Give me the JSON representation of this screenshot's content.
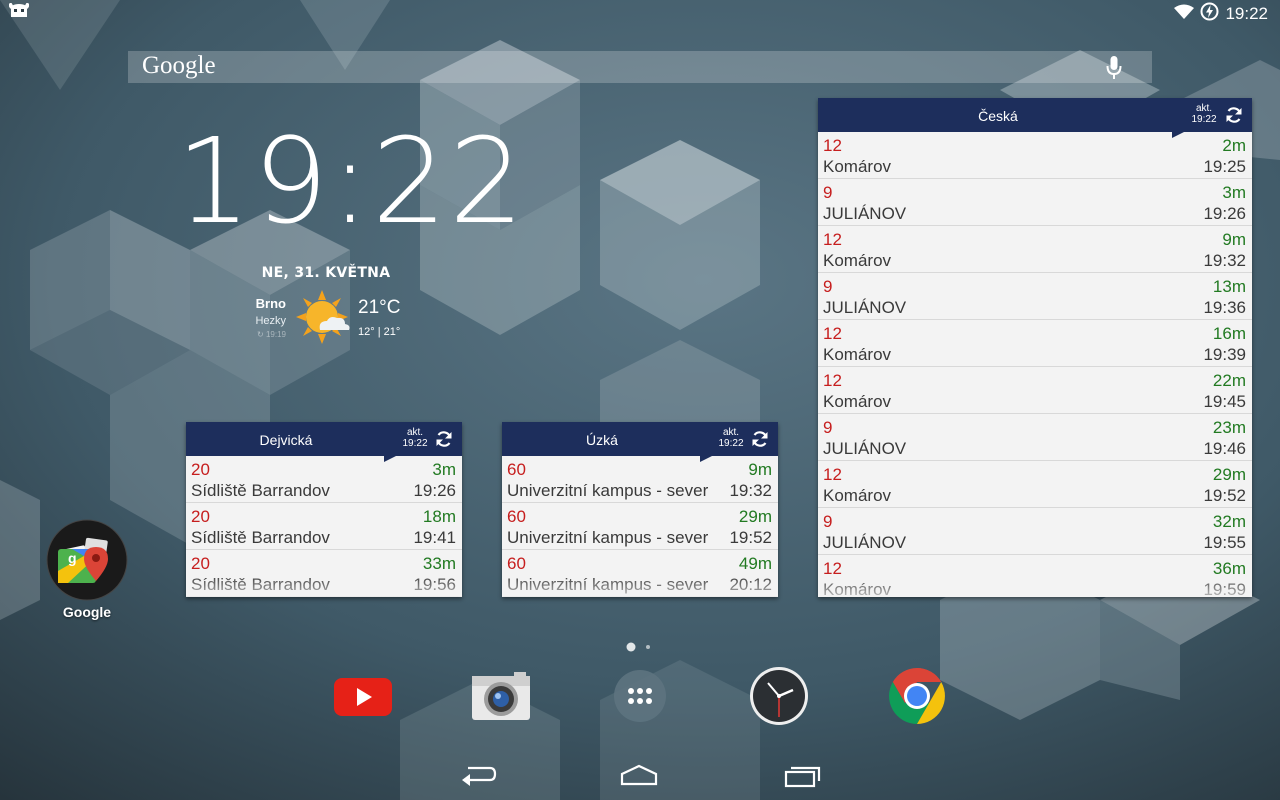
{
  "status": {
    "time": "19:22"
  },
  "search": {
    "logo": "Google"
  },
  "clock": {
    "time": "19:22",
    "date": "NE, 31. KVĚTNA"
  },
  "weather": {
    "city": "Brno",
    "condition": "Hezky",
    "updated": "↻ 19:19",
    "temp": "21°C",
    "range": "12° | 21°"
  },
  "widgets": {
    "dejvicka": {
      "title": "Dejvická",
      "akt": "akt.",
      "akt_time": "19:22",
      "rows": [
        {
          "line": "20",
          "dest": "Sídliště Barrandov",
          "mins": "3m",
          "time": "19:26"
        },
        {
          "line": "20",
          "dest": "Sídliště Barrandov",
          "mins": "18m",
          "time": "19:41"
        },
        {
          "line": "20",
          "dest": "Sídliště Barrandov",
          "mins": "33m",
          "time": "19:56"
        }
      ]
    },
    "uzka": {
      "title": "Úzká",
      "akt": "akt.",
      "akt_time": "19:22",
      "rows": [
        {
          "line": "60",
          "dest": "Univerzitní kampus - sever",
          "mins": "9m",
          "time": "19:32"
        },
        {
          "line": "60",
          "dest": "Univerzitní kampus - sever",
          "mins": "29m",
          "time": "19:52"
        },
        {
          "line": "60",
          "dest": "Univerzitní kampus - sever",
          "mins": "49m",
          "time": "20:12"
        }
      ]
    },
    "ceska": {
      "title": "Česká",
      "akt": "akt.",
      "akt_time": "19:22",
      "rows": [
        {
          "line": "12",
          "dest": "Komárov",
          "mins": "2m",
          "time": "19:25"
        },
        {
          "line": "9",
          "dest": "JULIÁNOV",
          "mins": "3m",
          "time": "19:26"
        },
        {
          "line": "12",
          "dest": "Komárov",
          "mins": "9m",
          "time": "19:32"
        },
        {
          "line": "9",
          "dest": "JULIÁNOV",
          "mins": "13m",
          "time": "19:36"
        },
        {
          "line": "12",
          "dest": "Komárov",
          "mins": "16m",
          "time": "19:39"
        },
        {
          "line": "12",
          "dest": "Komárov",
          "mins": "22m",
          "time": "19:45"
        },
        {
          "line": "9",
          "dest": "JULIÁNOV",
          "mins": "23m",
          "time": "19:46"
        },
        {
          "line": "12",
          "dest": "Komárov",
          "mins": "29m",
          "time": "19:52"
        },
        {
          "line": "9",
          "dest": "JULIÁNOV",
          "mins": "32m",
          "time": "19:55"
        },
        {
          "line": "12",
          "dest": "Komárov",
          "mins": "36m",
          "time": "19:59"
        }
      ]
    }
  },
  "apps": {
    "google_label": "Google"
  },
  "dock": {
    "items": [
      "youtube-icon",
      "camera-icon",
      "app-drawer-icon",
      "clock-icon",
      "chrome-icon"
    ]
  },
  "colors": {
    "widget_header": "#1d2e5c",
    "line_number": "#c61e1e",
    "minutes": "#227a22"
  }
}
